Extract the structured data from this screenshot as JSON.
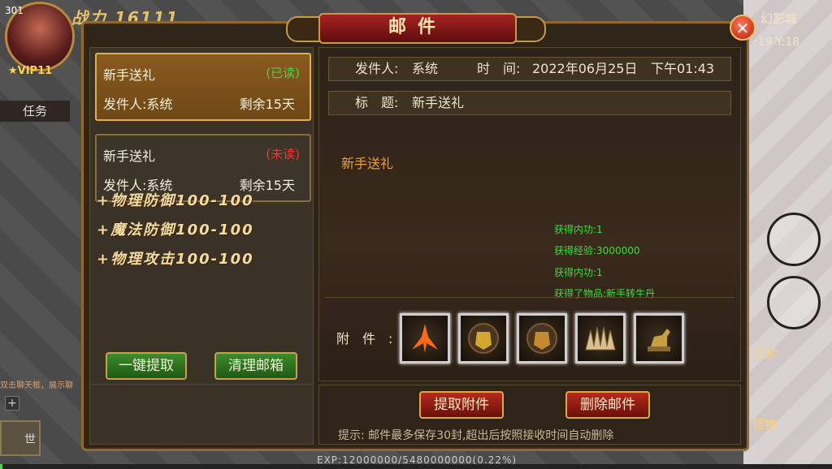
{
  "hud": {
    "level": "301",
    "power": "战力 16111",
    "vip": "★VIP11",
    "task_tab": "任务",
    "map_name": "幻影城",
    "coords": ":19  Y:18",
    "player_btn": "玩家",
    "monster_btn": "怪物",
    "chat_snippet": "双击聊天框，展示聊",
    "plus": "+",
    "mic_label": "世",
    "exp_text": "EXP:12000000/5480000000(0.22%)",
    "exp_fraction": 0.0022
  },
  "window": {
    "title": "邮件",
    "close_label": "✕"
  },
  "mail_list": [
    {
      "title": "新手送礼",
      "status": "(已读)",
      "from": "发件人:系统",
      "remaining": "剩余15天"
    },
    {
      "title": "新手送礼",
      "status": "(未读)",
      "from": "发件人:系统",
      "remaining": "剩余15天"
    }
  ],
  "stats": [
    "+物理防御100-100",
    "+魔法防御100-100",
    "+物理攻击100-100"
  ],
  "left_buttons": {
    "collect_all": "一键提取",
    "clear_mailbox": "清理邮箱"
  },
  "detail": {
    "sender_label": "发件人:",
    "sender": "系统",
    "time_label": "时　间:",
    "date": "2022年06月25日",
    "clock": "下午01:43",
    "subject_label": "标　题:",
    "subject": "新手送礼",
    "body_title": "新手送礼",
    "rewards": [
      "获得内功:1",
      "获得经验:3000000",
      "获得内功:1",
      "获得了物品:新手转生丹"
    ],
    "attachments_label": "附件:",
    "attachments": [
      {
        "icon": "flame-sword-icon",
        "color": "#ff6a1a"
      },
      {
        "icon": "golden-armor-icon",
        "color": "#d4a830"
      },
      {
        "icon": "golden-armor-icon",
        "color": "#c48a30"
      },
      {
        "icon": "spiked-item-icon",
        "color": "#d8c090"
      },
      {
        "icon": "horse-statue-icon",
        "color": "#c8a040"
      }
    ]
  },
  "right_buttons": {
    "collect_attachment": "提取附件",
    "delete_mail": "删除邮件"
  },
  "tip": "提示: 邮件最多保存30封,超出后按照接收时间自动删除"
}
